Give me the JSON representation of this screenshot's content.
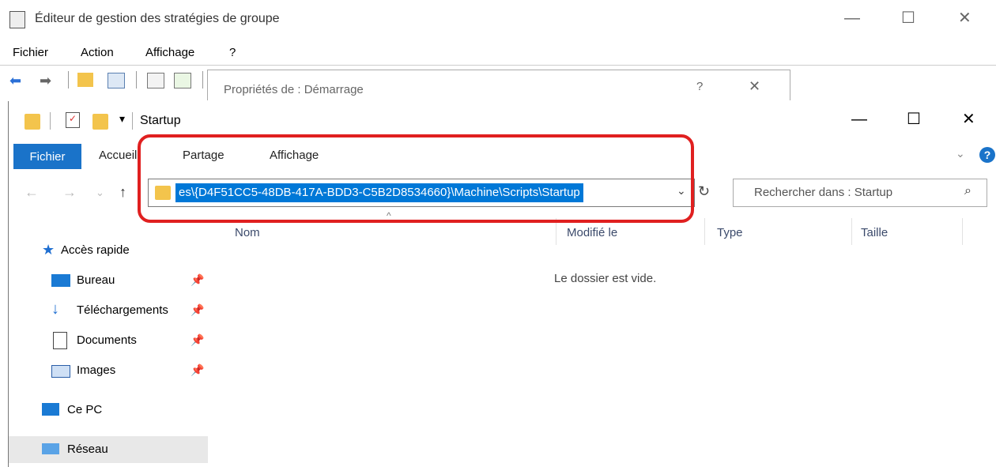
{
  "gpedit": {
    "title": "Éditeur de gestion des stratégies de groupe",
    "menu": [
      "Fichier",
      "Action",
      "Affichage",
      "?"
    ],
    "controls": {
      "minimize": "—",
      "maximize": "☐",
      "close": "✕"
    }
  },
  "dialog": {
    "title": "Propriétés de : Démarrage",
    "help": "?",
    "close": "✕"
  },
  "explorer": {
    "title": "Startup",
    "ribbon_tabs": {
      "file": "Fichier",
      "home": "Accueil",
      "share": "Partage",
      "view": "Affichage"
    },
    "controls": {
      "minimize": "—",
      "maximize": "☐",
      "close": "✕"
    },
    "address": "es\\{D4F51CC5-48DB-417A-BDD3-C5B2D8534660}\\Machine\\Scripts\\Startup",
    "search_placeholder": "Rechercher dans : Startup",
    "columns": {
      "name": "Nom",
      "modified": "Modifié le",
      "type": "Type",
      "size": "Taille"
    },
    "empty_message": "Le dossier est vide.",
    "nav": {
      "quick_access": "Accès rapide",
      "desktop": "Bureau",
      "downloads": "Téléchargements",
      "documents": "Documents",
      "images": "Images",
      "this_pc": "Ce PC",
      "network": "Réseau"
    }
  },
  "colors": {
    "accent": "#0078d7",
    "highlight_box": "#e02020",
    "file_tab": "#1a73c9"
  }
}
